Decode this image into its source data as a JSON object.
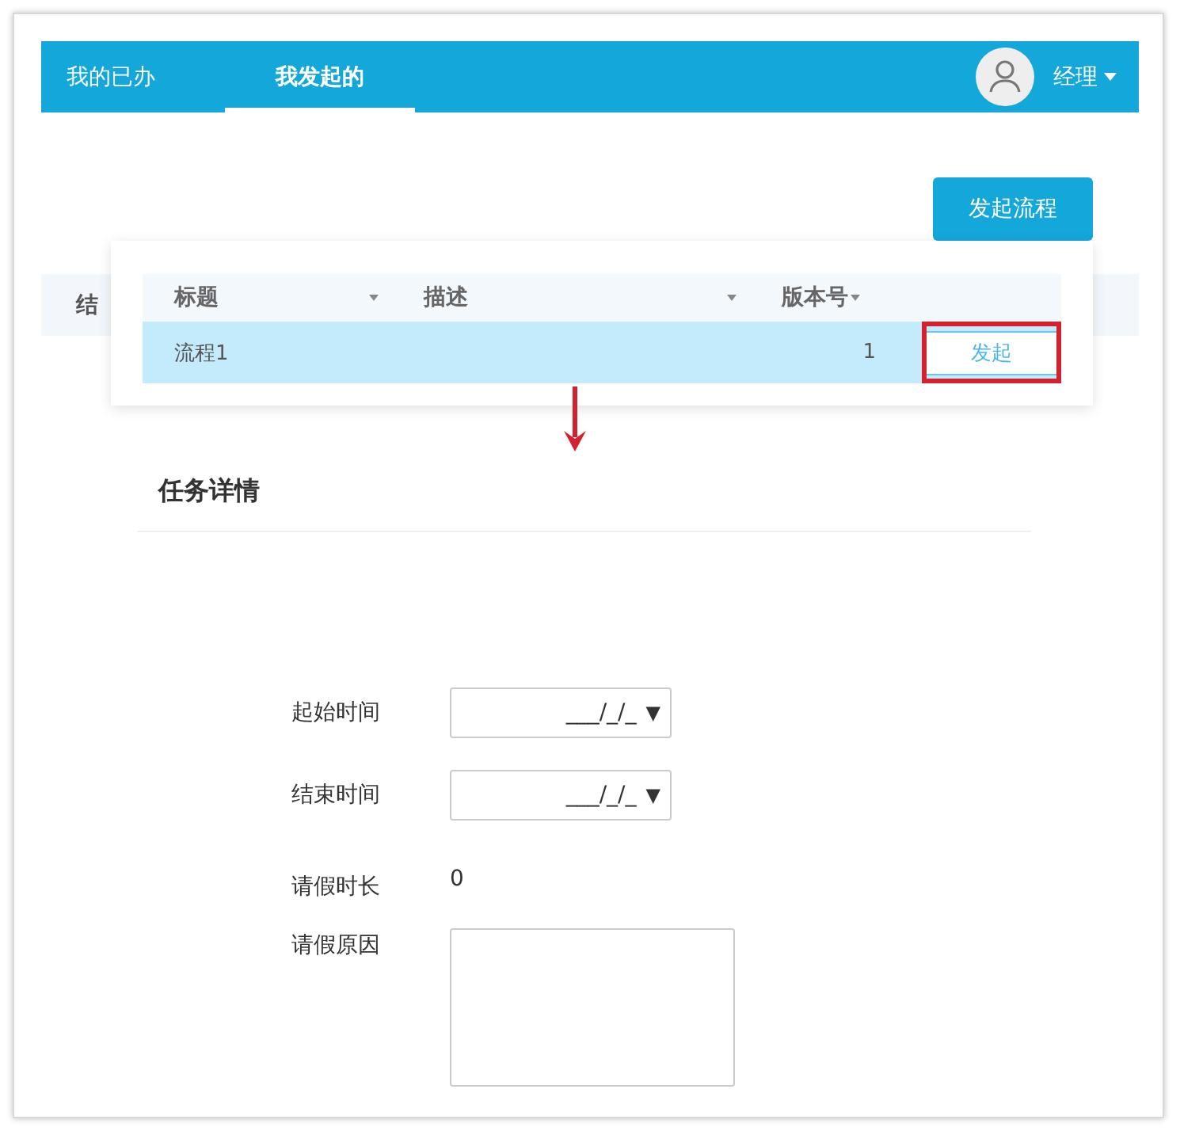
{
  "nav": {
    "tabs": [
      {
        "label": "我的已办",
        "selected": false
      },
      {
        "label": "我发起的",
        "selected": true
      }
    ],
    "user": {
      "name": "经理"
    }
  },
  "toolbar": {
    "button": "发起流程"
  },
  "background_row": {
    "text": "结"
  },
  "process_table": {
    "columns": [
      {
        "label": "标题",
        "sortable": true
      },
      {
        "label": "描述",
        "sortable": true
      },
      {
        "label": "版本号",
        "sortable": true
      }
    ],
    "rows": [
      {
        "title": "流程1",
        "version": "1",
        "action": "发起",
        "selected": true,
        "highlighted": true
      }
    ]
  },
  "detail": {
    "title": "任务详情",
    "fields": [
      {
        "kind": "date",
        "label": "起始时间",
        "value": "___/_/_",
        "arrow": "▼"
      },
      {
        "kind": "date",
        "label": "结束时间",
        "value": "___/_/_",
        "arrow": "▼"
      },
      {
        "kind": "text",
        "label": "请假时长",
        "value": "0"
      },
      {
        "kind": "textarea",
        "label": "请假原因"
      }
    ]
  }
}
